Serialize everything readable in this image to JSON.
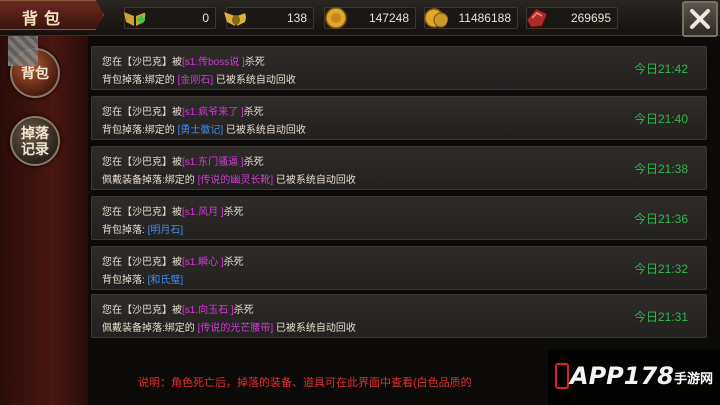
{
  "header": {
    "title": "背包",
    "resources": [
      {
        "icon": "green-plus-wings-icon",
        "value": "0"
      },
      {
        "icon": "gold-wings-icon",
        "value": "138"
      },
      {
        "icon": "gold-coin-icon",
        "value": "147248"
      },
      {
        "icon": "gold-coin-stack-icon",
        "value": "11486188"
      },
      {
        "icon": "red-gem-icon",
        "value": "269695"
      }
    ]
  },
  "sidebar": {
    "bag_label": "背包",
    "drop_label_1": "掉落",
    "drop_label_2": "记录"
  },
  "entries": [
    {
      "prefix": "您在【沙巴克】被",
      "killer": "[s1.传boss说 ]",
      "suffix": "杀死",
      "line2_prefix": "背包掉落:绑定的 ",
      "item": "[金刚石]",
      "item_color": "mag",
      "line2_suffix": " 已被系统自动回收",
      "time": "今日21:42"
    },
    {
      "prefix": "您在【沙巴克】被",
      "killer": "[s1.疯爷来了 ]",
      "suffix": "杀死",
      "line2_prefix": "背包掉落:绑定的 ",
      "item": "[勇士徽记]",
      "item_color": "blue",
      "line2_suffix": " 已被系统自动回收",
      "time": "今日21:40"
    },
    {
      "prefix": "您在【沙巴克】被",
      "killer": "[s1.东门骚逼 ]",
      "suffix": "杀死",
      "line2_prefix": "佩戴装备掉落:绑定的 ",
      "item": "[传说的幽灵长靴]",
      "item_color": "mag",
      "line2_suffix": " 已被系统自动回收",
      "time": "今日21:38"
    },
    {
      "prefix": "您在【沙巴克】被",
      "killer": "[s1.风月 ]",
      "suffix": "杀死",
      "line2_prefix": "背包掉落: ",
      "item": "[明月石]",
      "item_color": "blue",
      "line2_suffix": "",
      "time": "今日21:36"
    },
    {
      "prefix": "您在【沙巴克】被",
      "killer": "[s1.瞬心 ]",
      "suffix": "杀死",
      "line2_prefix": "背包掉落: ",
      "item": "[和氏璧]",
      "item_color": "blue",
      "line2_suffix": "",
      "time": "今日21:32"
    },
    {
      "prefix": "您在【沙巴克】被",
      "killer": "[s1.向玉石 ]",
      "suffix": "杀死",
      "line2_prefix": "佩戴装备掉落:绑定的 ",
      "item": "[传说的光芒腰带]",
      "item_color": "mag",
      "line2_suffix": " 已被系统自动回收",
      "time": "今日21:31"
    }
  ],
  "footer_note": "说明：角色死亡后，掉落的装备、道具可在此界面中查看(白色品质的",
  "watermark": {
    "text": "APP178",
    "sub": "手游网"
  },
  "colors": {
    "killer": "#d23ad6",
    "item_mag": "#d23ad6",
    "item_blue": "#3e8ef0",
    "time": "#2fb94a",
    "footer": "#e03030"
  }
}
